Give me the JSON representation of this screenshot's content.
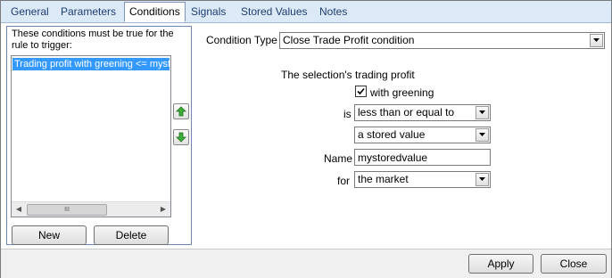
{
  "tabs": [
    {
      "label": "General"
    },
    {
      "label": "Parameters"
    },
    {
      "label": "Conditions"
    },
    {
      "label": "Signals"
    },
    {
      "label": "Stored Values"
    },
    {
      "label": "Notes"
    }
  ],
  "active_tab": "Conditions",
  "conditions_group": {
    "caption": "These conditions must be true for the rule to trigger:",
    "items": [
      "Trading profit with greening <= mystoredvalue"
    ],
    "new_label": "New",
    "delete_label": "Delete"
  },
  "form": {
    "condition_type_label": "Condition Type",
    "condition_type_value": "Close Trade Profit condition",
    "description": "The selection's trading profit",
    "greening_label": "with greening",
    "greening_checked": true,
    "is_label": "is",
    "operator_value": "less than or equal to",
    "source_value": "a stored value",
    "name_label": "Name",
    "name_value": "mystoredvalue",
    "for_label": "for",
    "for_value": "the market"
  },
  "footer": {
    "apply_label": "Apply",
    "close_label": "Close"
  }
}
